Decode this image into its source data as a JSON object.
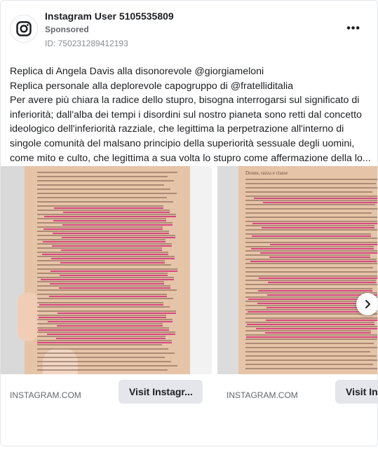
{
  "post": {
    "author": "Instagram User 5105535809",
    "sponsored": "Sponsored",
    "ad_id": "ID: 750231289412193",
    "more_icon": "more-horizontal-icon",
    "avatar_icon": "instagram-logo-icon"
  },
  "text": {
    "line1": "Replica di Angela Davis alla disonorevole @giorgiameloni",
    "line2": "Replica personale alla deplorevole capogruppo di @fratelliditalia",
    "line3": "Per avere più chiara la radice dello stupro, bisogna interrogarsi sul significato di",
    "line4": "inferiorità; dall'alba dei tempi i disordini sul nostro pianeta sono retti dal concetto",
    "line5": "ideologico dell'inferiorità razziale, che legittima la perpetrazione all'interno di",
    "line6": "singole comunità del malsano principio della superiorità sessuale degli uomini,",
    "line7": "come mito e culto, che legittima a sua volta lo stupro come affermazione della lo..."
  },
  "carousel": {
    "slides": [
      {
        "domain": "INSTAGRAM.COM",
        "cta": "Visit Instagr..."
      },
      {
        "domain": "INSTAGRAM.COM",
        "cta": "Visit Ins",
        "page_header": "Donne, razza e classe"
      }
    ],
    "next_icon": "chevron-right-icon"
  },
  "colors": {
    "highlight": "#d4307a",
    "cta_bg": "#e4e6eb",
    "page_paper": "#e6c4a8"
  }
}
